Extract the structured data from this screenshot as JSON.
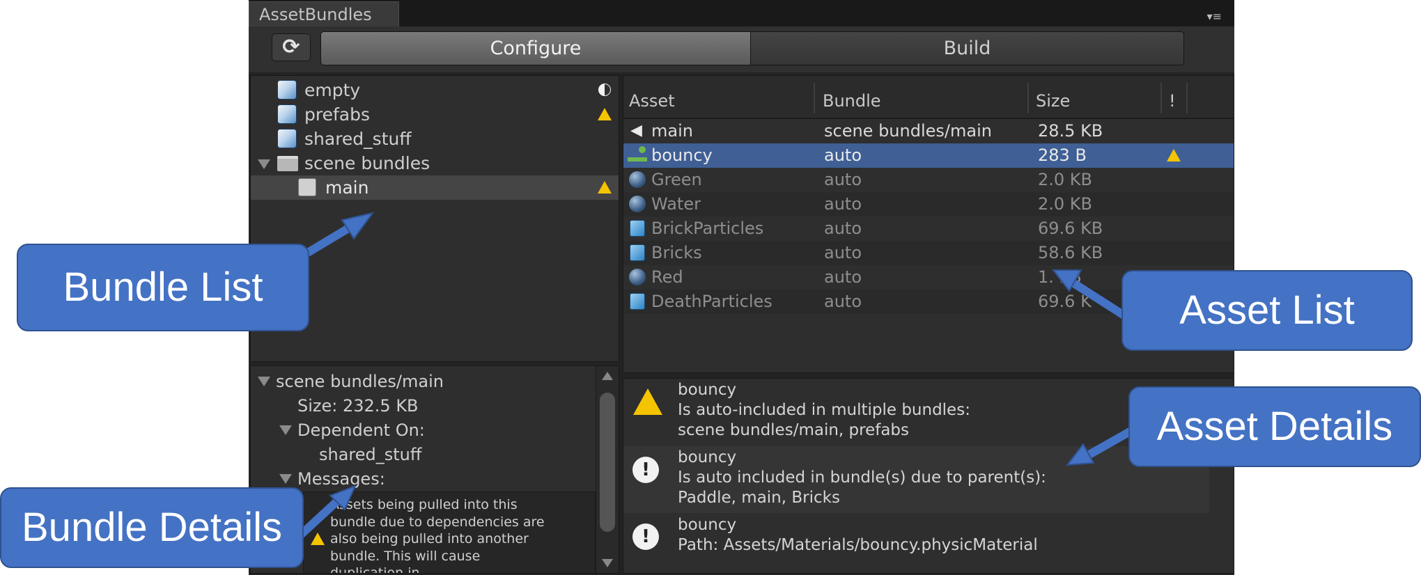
{
  "window": {
    "tab_title": "AssetBundles",
    "menu_icon": "▾≡"
  },
  "toolbar": {
    "refresh_icon": "⟳",
    "tabs": [
      {
        "label": "Configure",
        "active": true
      },
      {
        "label": "Build",
        "active": false
      }
    ]
  },
  "bundle_list": {
    "items": [
      {
        "name": "empty",
        "icon": "bundle-cube-icon",
        "status_icon": "info-half-circle-icon"
      },
      {
        "name": "prefabs",
        "icon": "bundle-cube-icon",
        "status_icon": "warning-icon"
      },
      {
        "name": "shared_stuff",
        "icon": "bundle-cube-icon",
        "status_icon": ""
      },
      {
        "name": "scene bundles",
        "icon": "folder-icon",
        "status_icon": "",
        "expanded": true
      },
      {
        "name": "main",
        "icon": "scene-bundle-icon",
        "status_icon": "warning-icon",
        "selected": true
      }
    ]
  },
  "bundle_details": {
    "title": "scene bundles/main",
    "size": "Size: 232.5 KB",
    "dependent_on_label": "Dependent On:",
    "dependencies": [
      "shared_stuff"
    ],
    "messages_label": "Messages:",
    "message_text": "Assets being pulled into this\nbundle due to dependencies are\nalso being pulled into another\nbundle.  This will cause\nduplication in"
  },
  "asset_list": {
    "columns": [
      "Asset",
      "Bundle",
      "Size",
      "!"
    ],
    "rows": [
      {
        "asset": "main",
        "bundle": "scene bundles/main",
        "size": "28.5 KB",
        "icon": "scene-speaker-icon",
        "warning": false,
        "selected": false
      },
      {
        "asset": "bouncy",
        "bundle": "auto",
        "size": "283 B",
        "icon": "physic-material-icon",
        "warning": true,
        "selected": true
      },
      {
        "asset": "Green",
        "bundle": "auto",
        "size": "2.0 KB",
        "icon": "material-sphere-icon",
        "warning": false,
        "selected": false
      },
      {
        "asset": "Water",
        "bundle": "auto",
        "size": "2.0 KB",
        "icon": "material-sphere-icon",
        "warning": false,
        "selected": false
      },
      {
        "asset": "BrickParticles",
        "bundle": "auto",
        "size": "69.6 KB",
        "icon": "prefab-cube-icon",
        "warning": false,
        "selected": false
      },
      {
        "asset": "Bricks",
        "bundle": "auto",
        "size": "58.6 KB",
        "icon": "prefab-cube-icon",
        "warning": false,
        "selected": false
      },
      {
        "asset": "Red",
        "bundle": "auto",
        "size": "1. KB",
        "icon": "material-sphere-icon",
        "warning": false,
        "selected": false
      },
      {
        "asset": "DeathParticles",
        "bundle": "auto",
        "size": "69.6 K",
        "icon": "prefab-cube-icon",
        "warning": false,
        "selected": false
      }
    ]
  },
  "asset_details": {
    "messages": [
      {
        "icon": "warning-icon",
        "text": "bouncy\nIs auto-included in multiple bundles:\nscene bundles/main, prefabs"
      },
      {
        "icon": "info-icon",
        "text": "bouncy\nIs auto included in bundle(s) due to parent(s):\nPaddle, main, Bricks"
      },
      {
        "icon": "info-icon",
        "text": "bouncy\nPath: Assets/Materials/bouncy.physicMaterial"
      }
    ]
  },
  "callouts": {
    "bundle_list": "Bundle List",
    "asset_list": "Asset List",
    "asset_details": "Asset Details",
    "bundle_details": "Bundle Details"
  },
  "colors": {
    "callout_fill": "#4472c4",
    "selection": "#3f5f95",
    "warning": "#f5c400"
  }
}
